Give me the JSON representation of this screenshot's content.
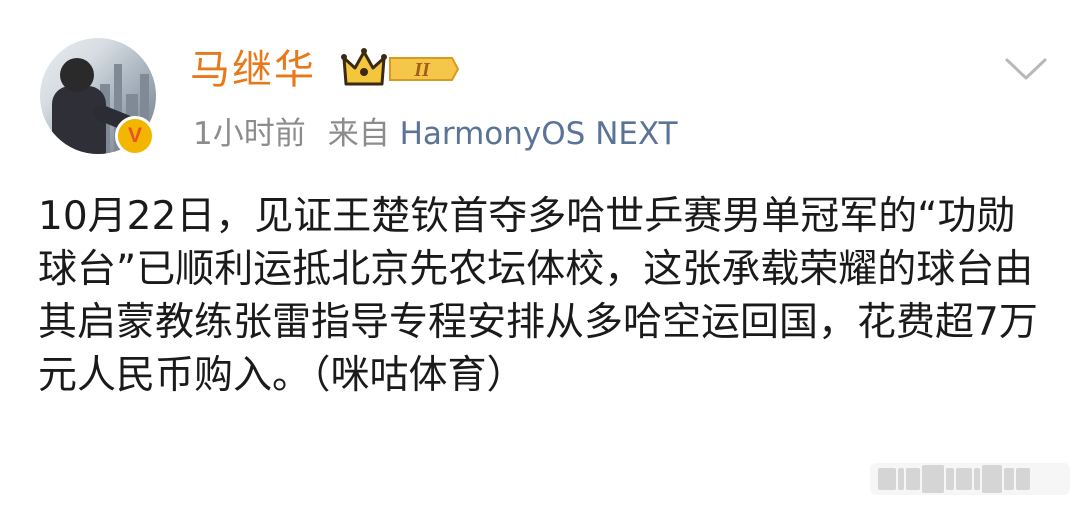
{
  "post": {
    "author": {
      "name": "马继华",
      "verified_mark": "V",
      "level_badge": "II",
      "avatar": "avatar"
    },
    "time": "1小时前",
    "source_prefix": "来自",
    "source_name": "HarmonyOS NEXT",
    "text": "10月22日，见证王楚钦首夺多哈世乒赛男单冠军的“功勋球台”已顺利运抵北京先农坛体校，这张承载荣耀的球台由其启蒙教练张雷指导专程安排从多哈空运回国，花费超7万元人民币购入。（咪咕体育）"
  },
  "icons": {
    "menu": "chevron-down-icon",
    "level": "crown-icon",
    "verified": "verified-v-icon",
    "watermark": "watermark-logo"
  },
  "colors": {
    "name": "#e8791a",
    "meta": "#8c8c8c",
    "source": "#5a7396",
    "text": "#1a1a1a",
    "verified_bg": "#f2b500"
  }
}
